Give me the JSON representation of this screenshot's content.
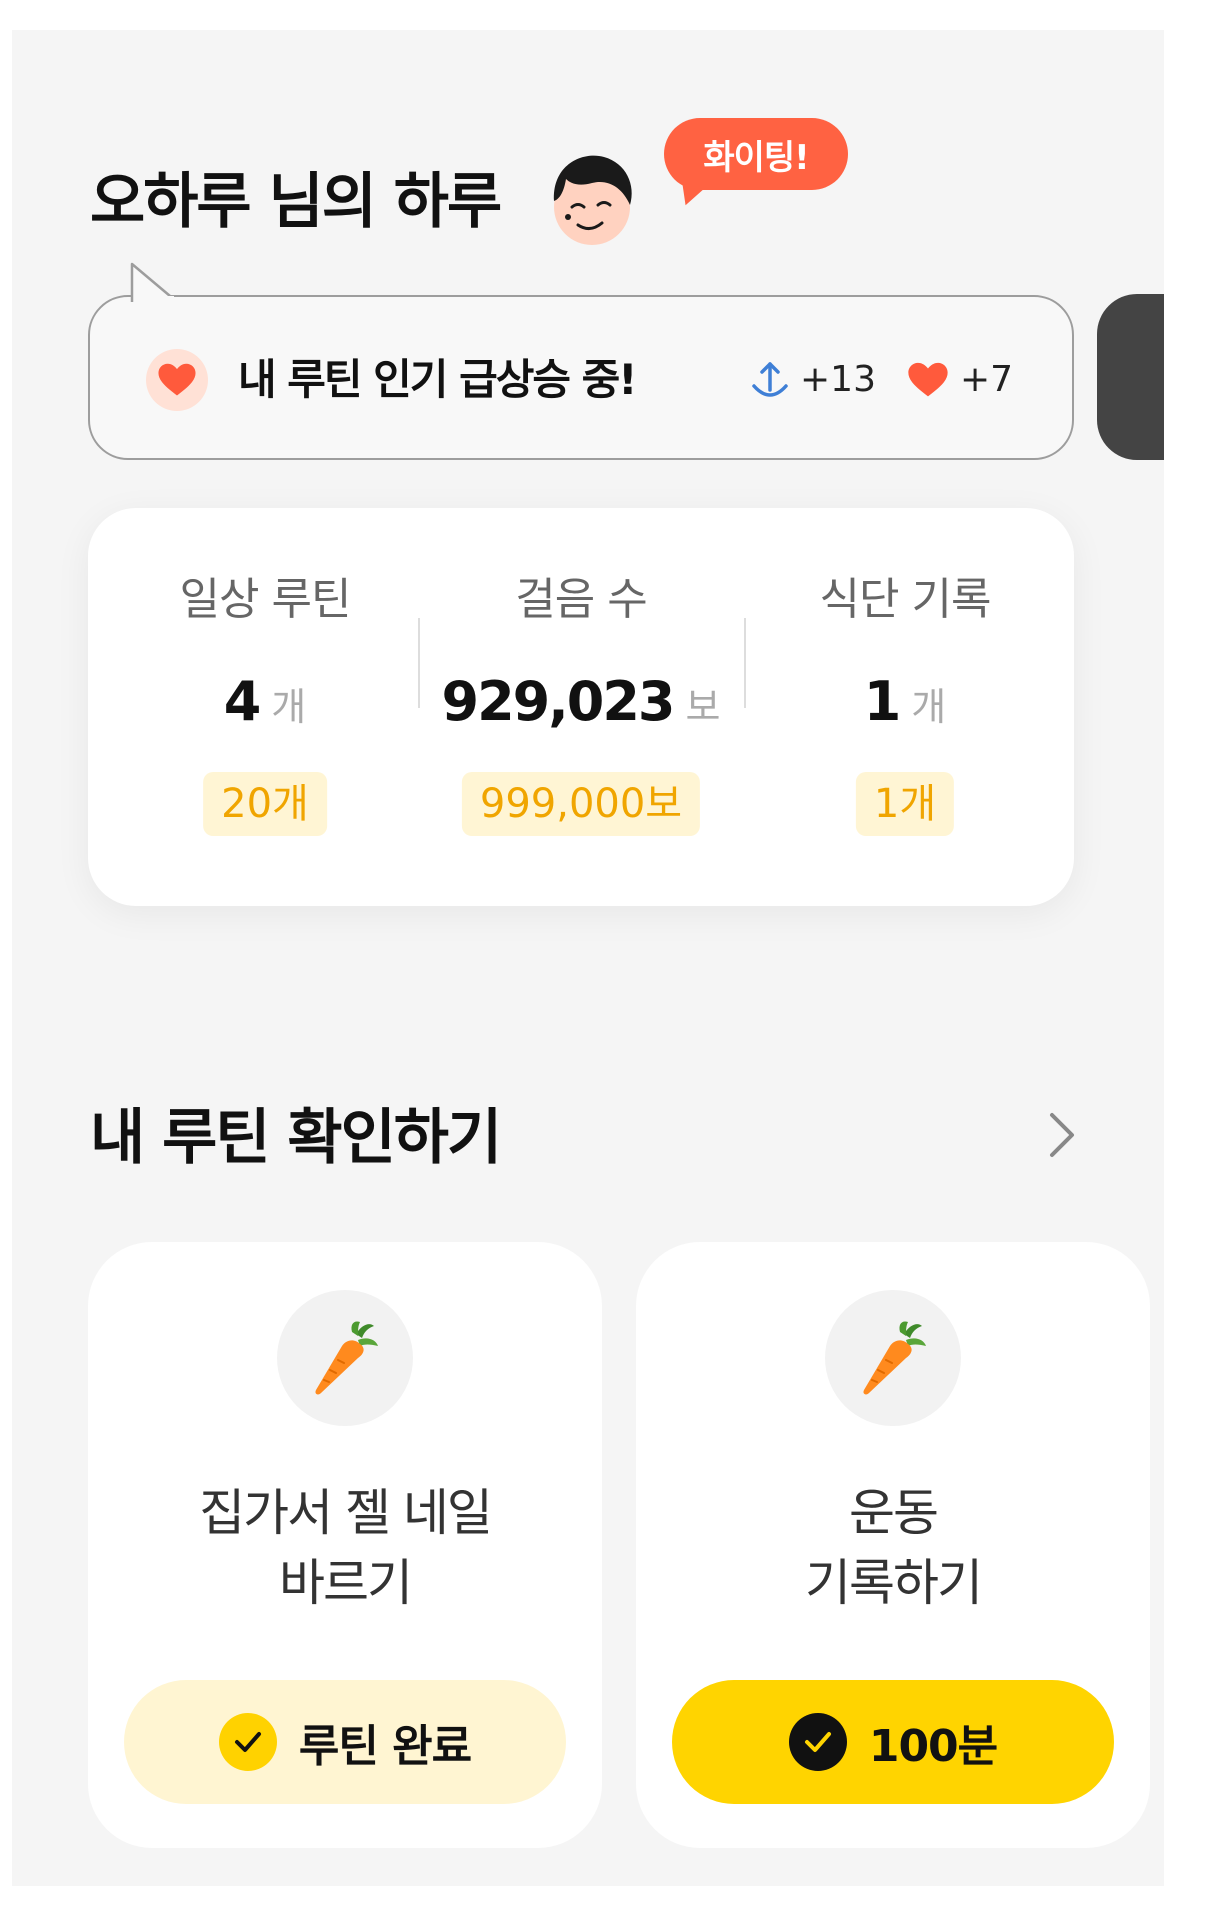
{
  "header": {
    "greeting": "오하루 님의 하루",
    "cheer": "화이팅!"
  },
  "trend": {
    "message": "내 루틴 인기 급상승 중!",
    "rank_change": "+13",
    "likes_change": "+7",
    "colors": {
      "heart": "#ff5a3c",
      "arrow": "#3f7fd6"
    }
  },
  "stats": [
    {
      "label": "일상 루틴",
      "value": "4",
      "unit": "개",
      "goal": "20개"
    },
    {
      "label": "걸음 수",
      "value": "929,023",
      "unit": "보",
      "goal": "999,000보"
    },
    {
      "label": "식단 기록",
      "value": "1",
      "unit": "개",
      "goal": "1개"
    }
  ],
  "routines_section": {
    "title": "내 루틴 확인하기"
  },
  "routines": [
    {
      "icon": "carrot-icon",
      "title": "집가서 젤 네일\n바르기",
      "button": "루틴 완료"
    },
    {
      "icon": "carrot-icon",
      "title": "운동\n기록하기",
      "button": "100분"
    }
  ],
  "colors": {
    "accent_yellow": "#ffd400",
    "soft_yellow": "#fff5d2",
    "cheer_orange": "#ff6242",
    "goal_text": "#f0a500"
  }
}
